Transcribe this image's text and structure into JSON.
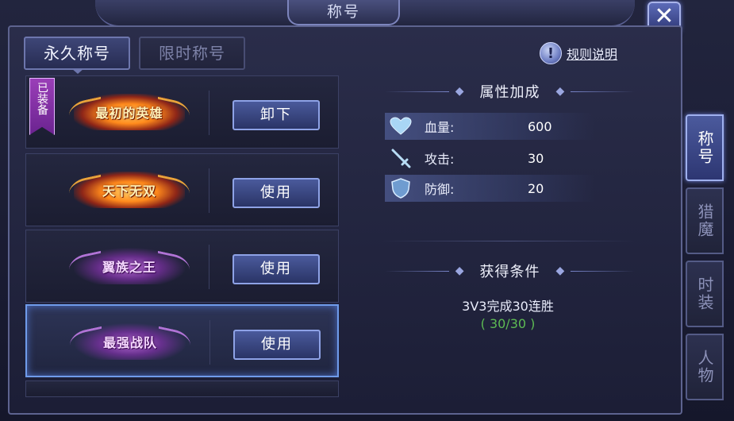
{
  "window": {
    "title": "称号",
    "close_icon": "close-icon"
  },
  "tabs": [
    {
      "label": "永久称号",
      "active": true
    },
    {
      "label": "限时称号",
      "active": false
    }
  ],
  "rules": {
    "icon": "exclamation-icon",
    "label": "规则说明"
  },
  "titles": [
    {
      "name": "最初的英雄",
      "style": "fire",
      "equipped_badge": "已装备",
      "button": "卸下",
      "selected": false
    },
    {
      "name": "天下无双",
      "style": "fire",
      "equipped_badge": "",
      "button": "使用",
      "selected": false
    },
    {
      "name": "翼族之王",
      "style": "purple",
      "equipped_badge": "",
      "button": "使用",
      "selected": false
    },
    {
      "name": "最强战队",
      "style": "purple",
      "equipped_badge": "",
      "button": "使用",
      "selected": true
    }
  ],
  "attributes": {
    "header": "属性加成",
    "items": [
      {
        "icon": "heart-icon",
        "label": "血量:",
        "value": "600"
      },
      {
        "icon": "sword-icon",
        "label": "攻击:",
        "value": "30"
      },
      {
        "icon": "shield-icon",
        "label": "防御:",
        "value": "20"
      }
    ]
  },
  "condition": {
    "header": "获得条件",
    "text": "3V3完成30连胜",
    "progress": "( 30/30 )",
    "progress_color": "#5dbb53"
  },
  "side_tabs": [
    {
      "label": "称号",
      "active": true
    },
    {
      "label": "猎魔",
      "active": false
    },
    {
      "label": "时装",
      "active": false
    },
    {
      "label": "人物",
      "active": false
    }
  ]
}
